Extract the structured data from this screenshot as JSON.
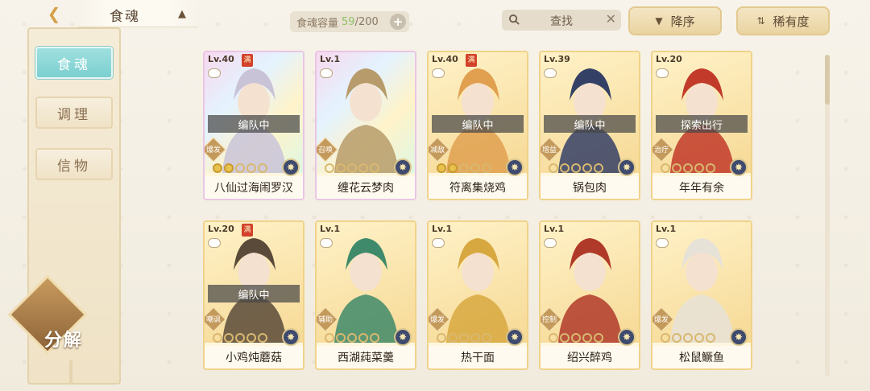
{
  "header": {
    "title": "食魂",
    "capacity_label": "食魂容量",
    "capacity_current": "59",
    "capacity_total": "/200",
    "search_placeholder": "查找",
    "sort_order": "降序",
    "sort_field": "稀有度"
  },
  "sidebar": {
    "tabs": [
      {
        "label": "食魂"
      },
      {
        "label": "调理"
      },
      {
        "label": "信物"
      }
    ],
    "decompose": "分解"
  },
  "cards": [
    {
      "level": "Lv.40",
      "full": "满",
      "status": "编队中",
      "role": "爆发",
      "name": "八仙过海闹罗汉",
      "stars_filled": 2,
      "rainbow": true,
      "accent": "#c9c3d8"
    },
    {
      "level": "Lv.1",
      "full": "",
      "status": "",
      "role": "召唤",
      "name": "缠花云梦肉",
      "stars_filled": 0,
      "rainbow": true,
      "accent": "#b79b6a"
    },
    {
      "level": "Lv.40",
      "full": "满",
      "status": "编队中",
      "role": "减敌",
      "name": "符离集烧鸡",
      "stars_filled": 2,
      "rainbow": false,
      "accent": "#e0a050"
    },
    {
      "level": "Lv.39",
      "full": "",
      "status": "编队中",
      "role": "增益",
      "name": "锅包肉",
      "stars_filled": 0,
      "rainbow": false,
      "accent": "#354066"
    },
    {
      "level": "Lv.20",
      "full": "",
      "status": "探索出行",
      "role": "治疗",
      "name": "年年有余",
      "stars_filled": 0,
      "rainbow": false,
      "accent": "#c23a2a"
    },
    {
      "level": "Lv.20",
      "full": "满",
      "status": "编队中",
      "role": "嘲讽",
      "name": "小鸡炖蘑菇",
      "stars_filled": 0,
      "rainbow": false,
      "accent": "#5a4a3a"
    },
    {
      "level": "Lv.1",
      "full": "",
      "status": "",
      "role": "辅助",
      "name": "西湖莼菜羹",
      "stars_filled": 0,
      "rainbow": false,
      "accent": "#3f8a6a"
    },
    {
      "level": "Lv.1",
      "full": "",
      "status": "",
      "role": "爆发",
      "name": "热干面",
      "stars_filled": 0,
      "rainbow": false,
      "accent": "#d8a840"
    },
    {
      "level": "Lv.1",
      "full": "",
      "status": "",
      "role": "控制",
      "name": "绍兴醉鸡",
      "stars_filled": 0,
      "rainbow": false,
      "accent": "#b03a2a"
    },
    {
      "level": "Lv.1",
      "full": "",
      "status": "",
      "role": "爆发",
      "name": "松鼠鳜鱼",
      "stars_filled": 0,
      "rainbow": false,
      "accent": "#e7e2d8"
    }
  ]
}
